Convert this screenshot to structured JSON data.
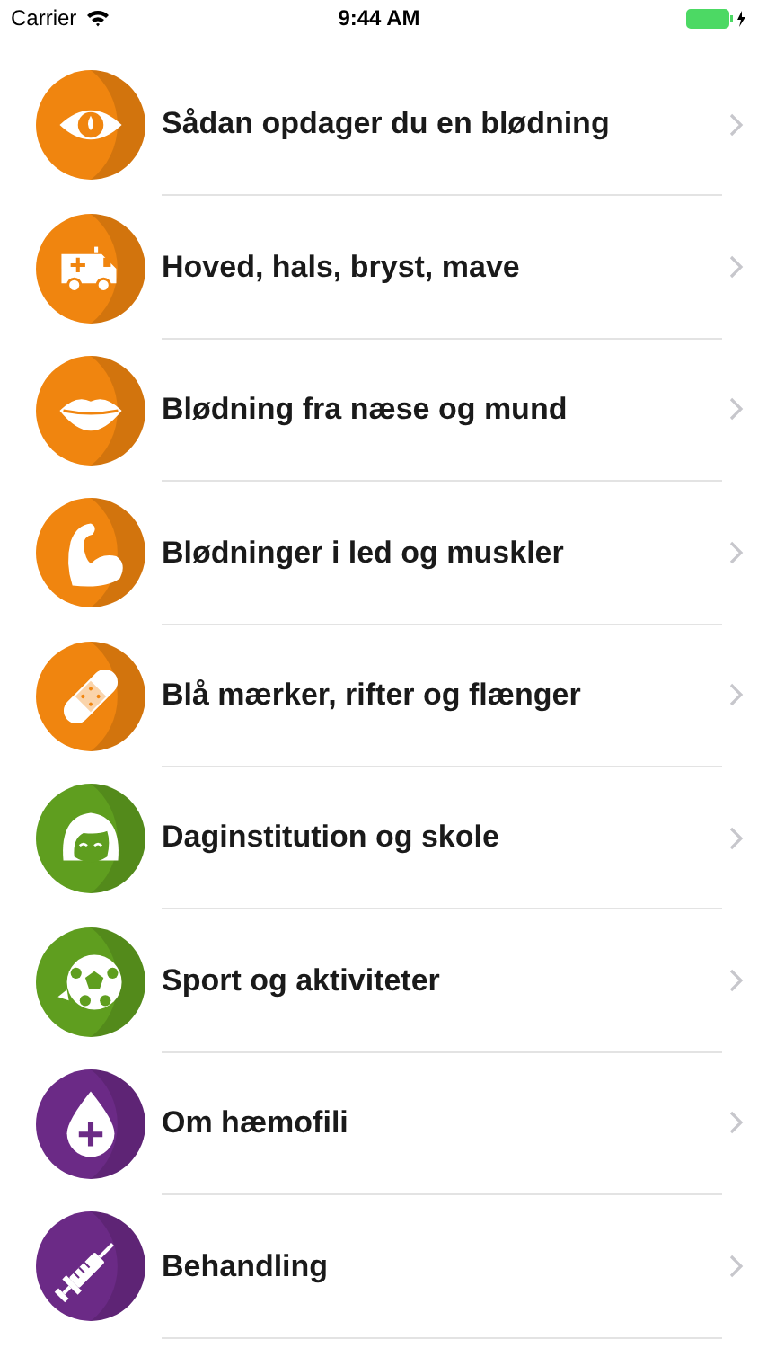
{
  "status_bar": {
    "carrier": "Carrier",
    "time": "9:44 AM"
  },
  "items": [
    {
      "label": "Sådan opdager du en blødning",
      "color": "#f0850f"
    },
    {
      "label": "Hoved, hals, bryst, mave",
      "color": "#f0850f"
    },
    {
      "label": "Blødning fra næse og mund",
      "color": "#f0850f"
    },
    {
      "label": "Blødninger i led og muskler",
      "color": "#f0850f"
    },
    {
      "label": "Blå mærker, rifter og flænger",
      "color": "#f0850f"
    },
    {
      "label": "Daginstitution og skole",
      "color": "#5f9e1f"
    },
    {
      "label": "Sport og aktiviteter",
      "color": "#5f9e1f"
    },
    {
      "label": "Om hæmofili",
      "color": "#6b2a86"
    },
    {
      "label": "Behandling",
      "color": "#6b2a86"
    }
  ]
}
